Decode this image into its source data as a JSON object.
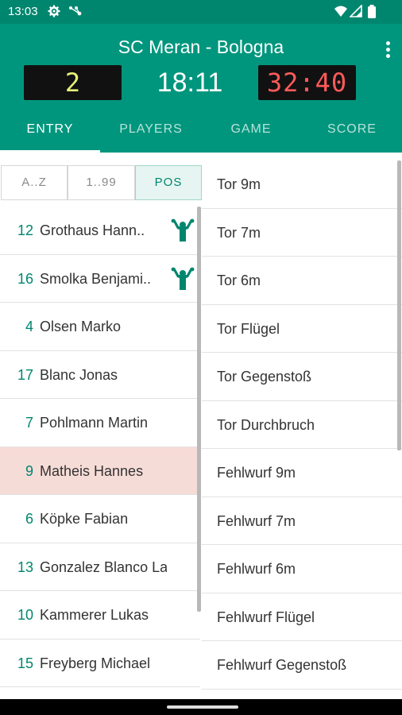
{
  "status_bar": {
    "time": "13:03",
    "icons": [
      "gear-icon",
      "network-dots-icon",
      "wifi-icon",
      "signal-icon",
      "battery-icon"
    ]
  },
  "app_bar": {
    "title": "SC Meran - Bologna",
    "home_score": "2",
    "game_clock": "18:11",
    "away_score": "32:40",
    "menu_icon": "more-vert-icon"
  },
  "tabs": [
    {
      "label": "ENTRY",
      "active": true
    },
    {
      "label": "PLAYERS",
      "active": false
    },
    {
      "label": "GAME",
      "active": false
    },
    {
      "label": "SCORE",
      "active": false
    }
  ],
  "sort_options": [
    {
      "label": "A..Z",
      "active": false
    },
    {
      "label": "1..99",
      "active": false
    },
    {
      "label": "POS",
      "active": true
    }
  ],
  "players": [
    {
      "number": "12",
      "name": "Grothaus Hann..",
      "icon": "goalkeeper-icon",
      "selected": false
    },
    {
      "number": "16",
      "name": "Smolka Benjami..",
      "icon": "goalkeeper-icon",
      "selected": false
    },
    {
      "number": "4",
      "name": "Olsen Marko",
      "icon": "",
      "selected": false
    },
    {
      "number": "17",
      "name": "Blanc Jonas",
      "icon": "",
      "selected": false
    },
    {
      "number": "7",
      "name": "Pohlmann Martin",
      "icon": "",
      "selected": false
    },
    {
      "number": "9",
      "name": "Matheis Hannes",
      "icon": "",
      "selected": true
    },
    {
      "number": "6",
      "name": "Köpke Fabian",
      "icon": "",
      "selected": false
    },
    {
      "number": "13",
      "name": "Gonzalez Blanco La..",
      "icon": "",
      "selected": false
    },
    {
      "number": "10",
      "name": "Kammerer Lukas",
      "icon": "",
      "selected": false
    },
    {
      "number": "15",
      "name": "Freyberg Michael",
      "icon": "",
      "selected": false
    }
  ],
  "actions": [
    "Tor 9m",
    "Tor 7m",
    "Tor 6m",
    "Tor Flügel",
    "Tor Gegenstoß",
    "Tor Durchbruch",
    "Fehlwurf 9m",
    "Fehlwurf 7m",
    "Fehlwurf 6m",
    "Fehlwurf Flügel",
    "Fehlwurf Gegenstoß"
  ],
  "colors": {
    "primary": "#00967d",
    "status_bar": "#00866f",
    "accent_number": "#00866f",
    "selected_row": "#f6dcd7",
    "home_score": "#e6f07a",
    "away_score": "#ff5a5a"
  }
}
